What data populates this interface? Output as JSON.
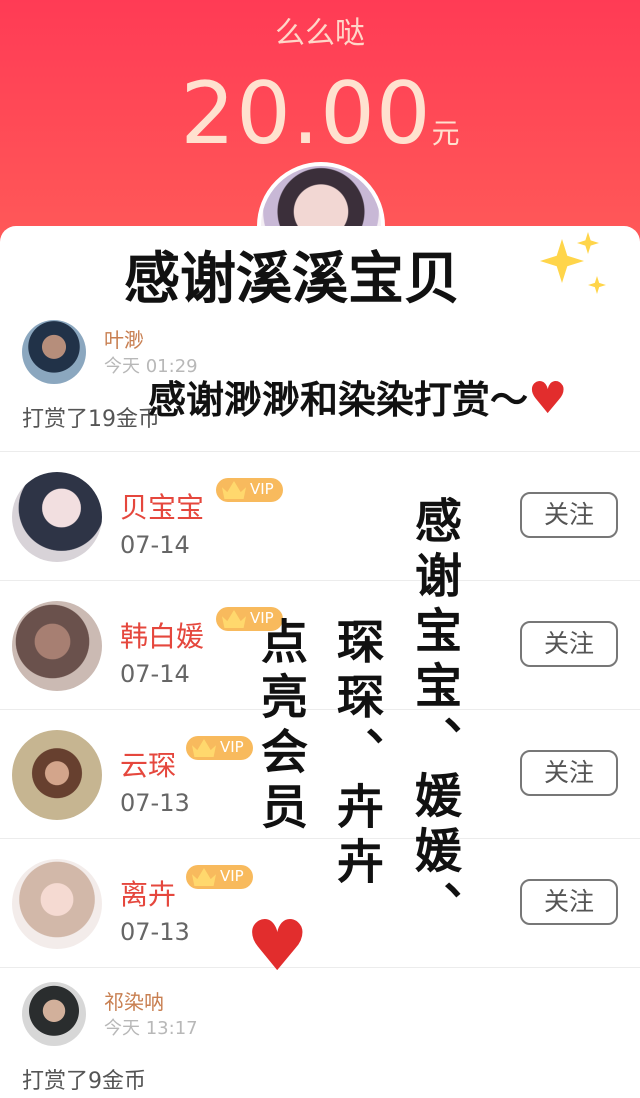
{
  "header": {
    "title": "么么哒",
    "amount": "20.00",
    "unit": "元"
  },
  "overlay": {
    "title": "感谢溪溪宝贝",
    "sparkle_icon": "sparkles-icon",
    "line": "感谢渺渺和染染打赏～",
    "heart_icon": "heart-icon",
    "vertical_1": "感谢宝宝、媛媛、",
    "vertical_2": "琛琛、卉卉",
    "vertical_3": "点亮会员"
  },
  "list": [
    {
      "kind": "reward",
      "name": "叶渺",
      "time": "今天 01:29",
      "action": "打赏了19金币"
    },
    {
      "kind": "member",
      "name": "贝宝宝",
      "vip": "VIP",
      "date": "07-14",
      "button": "关注"
    },
    {
      "kind": "member",
      "name": "韩白媛",
      "vip": "VIP",
      "date": "07-14",
      "button": "关注"
    },
    {
      "kind": "member",
      "name": "云琛",
      "vip": "VIP",
      "date": "07-13",
      "button": "关注"
    },
    {
      "kind": "member",
      "name": "离卉",
      "vip": "VIP",
      "date": "07-13",
      "button": "关注"
    },
    {
      "kind": "reward",
      "name": "祁染呐",
      "time": "今天 13:17",
      "action": "打赏了9金币"
    }
  ],
  "colors": {
    "header_red": "#ff4357",
    "amount_text": "#ffe1cf",
    "name_orange": "#c87f51",
    "member_red": "#e5473d",
    "vip_gold": "#f8ba5d",
    "heart_red": "#e22d2d"
  }
}
